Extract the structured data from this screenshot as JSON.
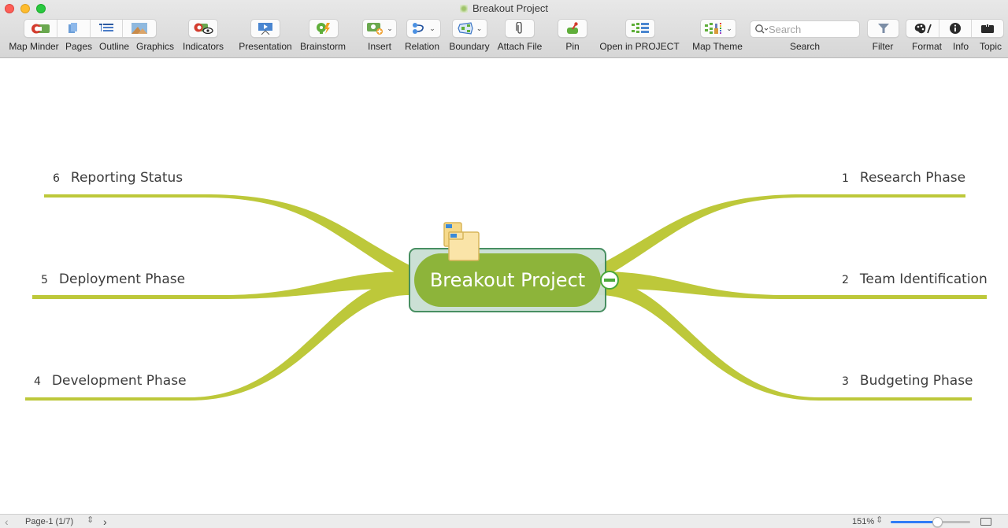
{
  "window": {
    "title": "Breakout Project",
    "traffic_lights": {
      "close": "#fd5f57",
      "minimize": "#febc2e",
      "maximize": "#29c840"
    }
  },
  "toolbar": {
    "items": [
      {
        "id": "map-minder",
        "label": "Map Minder",
        "icon": "map-minder-icon"
      },
      {
        "id": "pages",
        "label": "Pages",
        "icon": "pages-icon"
      },
      {
        "id": "outline",
        "label": "Outline",
        "icon": "outline-icon"
      },
      {
        "id": "graphics",
        "label": "Graphics",
        "icon": "graphics-icon"
      },
      {
        "id": "indicators",
        "label": "Indicators",
        "icon": "indicators-icon"
      },
      {
        "id": "presentation",
        "label": "Presentation",
        "icon": "presentation-icon"
      },
      {
        "id": "brainstorm",
        "label": "Brainstorm",
        "icon": "brainstorm-icon"
      },
      {
        "id": "insert",
        "label": "Insert",
        "icon": "insert-icon"
      },
      {
        "id": "relation",
        "label": "Relation",
        "icon": "relation-icon"
      },
      {
        "id": "boundary",
        "label": "Boundary",
        "icon": "boundary-icon"
      },
      {
        "id": "attach-file",
        "label": "Attach File",
        "icon": "paperclip-icon"
      },
      {
        "id": "pin",
        "label": "Pin",
        "icon": "pin-icon"
      },
      {
        "id": "open-in-project",
        "label": "Open in PROJECT",
        "icon": "project-icon"
      },
      {
        "id": "map-theme",
        "label": "Map Theme",
        "icon": "map-theme-icon"
      },
      {
        "id": "search",
        "label": "Search",
        "icon": "search-icon"
      },
      {
        "id": "filter",
        "label": "Filter",
        "icon": "filter-icon"
      },
      {
        "id": "format",
        "label": "Format",
        "icon": "palette-icon"
      },
      {
        "id": "info",
        "label": "Info",
        "icon": "info-icon"
      },
      {
        "id": "topic",
        "label": "Topic",
        "icon": "topic-icon"
      }
    ],
    "search_placeholder": "Search"
  },
  "mindmap": {
    "central_topic": "Breakout Project",
    "central_icon": "folders-icon",
    "branch_color": "#bdc83a",
    "central_fill": "#8db43a",
    "central_frame": "#c9dfd3",
    "branches": [
      {
        "number": "1",
        "label": "Research Phase",
        "side": "right"
      },
      {
        "number": "2",
        "label": "Team Identification",
        "side": "right"
      },
      {
        "number": "3",
        "label": "Budgeting Phase",
        "side": "right"
      },
      {
        "number": "4",
        "label": "Development Phase",
        "side": "left"
      },
      {
        "number": "5",
        "label": "Deployment Phase",
        "side": "left"
      },
      {
        "number": "6",
        "label": "Reporting Status",
        "side": "left"
      }
    ]
  },
  "statusbar": {
    "page_label": "Page-1 (1/7)",
    "zoom_label": "151%",
    "zoom_slider_fraction": 0.58
  }
}
